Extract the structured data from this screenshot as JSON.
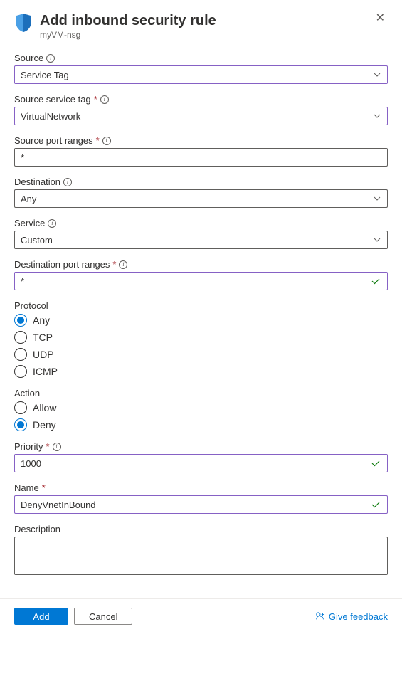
{
  "header": {
    "title": "Add inbound security rule",
    "subtitle": "myVM-nsg"
  },
  "fields": {
    "source": {
      "label": "Source",
      "value": "Service Tag"
    },
    "sourceServiceTag": {
      "label": "Source service tag",
      "value": "VirtualNetwork"
    },
    "sourcePortRanges": {
      "label": "Source port ranges",
      "value": "*"
    },
    "destination": {
      "label": "Destination",
      "value": "Any"
    },
    "service": {
      "label": "Service",
      "value": "Custom"
    },
    "destPortRanges": {
      "label": "Destination port ranges",
      "value": "*"
    },
    "protocol": {
      "label": "Protocol",
      "options": {
        "any": "Any",
        "tcp": "TCP",
        "udp": "UDP",
        "icmp": "ICMP"
      }
    },
    "action": {
      "label": "Action",
      "options": {
        "allow": "Allow",
        "deny": "Deny"
      }
    },
    "priority": {
      "label": "Priority",
      "value": "1000"
    },
    "name": {
      "label": "Name",
      "value": "DenyVnetInBound"
    },
    "description": {
      "label": "Description"
    }
  },
  "footer": {
    "add": "Add",
    "cancel": "Cancel",
    "feedback": "Give feedback"
  }
}
